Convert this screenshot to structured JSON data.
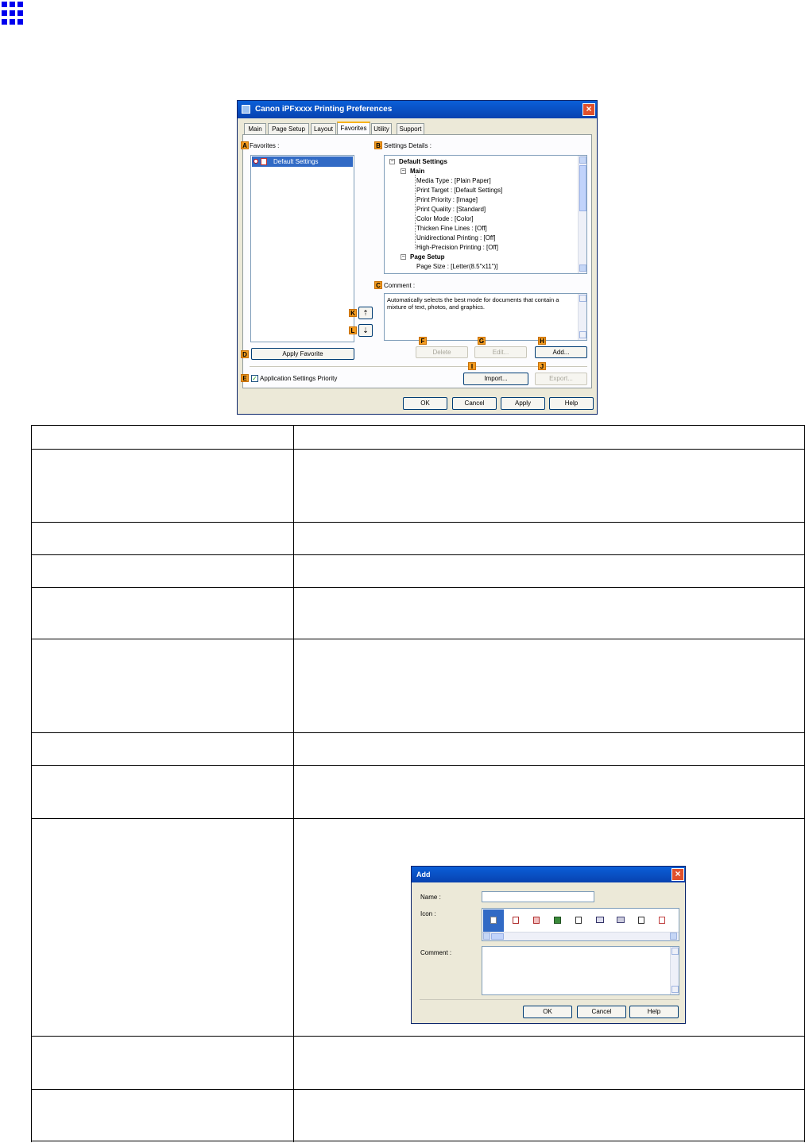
{
  "dialog": {
    "title": "Canon iPFxxxx Printing Preferences",
    "tabs": [
      "Main",
      "Page Setup",
      "Layout",
      "Favorites",
      "Utility",
      "Support"
    ],
    "selected_tab": "Favorites",
    "favorites_label": "Favorites :",
    "favorites_items": [
      "Default Settings"
    ],
    "settings_details_label": "Settings Details :",
    "tree": {
      "root": "Default Settings",
      "main_group": "Main",
      "main_items": [
        "Media Type : [Plain Paper]",
        "Print Target : [Default Settings]",
        "Print Priority : [Image]",
        "Print Quality : [Standard]",
        "Color Mode : [Color]",
        "Thicken Fine Lines : [Off]",
        "Unidirectional Printing : [Off]",
        "High-Precision Printing : [Off]"
      ],
      "page_group": "Page Setup",
      "page_items": [
        "Page Size : [Letter(8.5\"x11\")]"
      ]
    },
    "comment_label": "Comment :",
    "comment_text": "Automatically selects the best mode for documents that contain a mixture of text, photos, and graphics.",
    "buttons": {
      "delete": "Delete",
      "edit": "Edit...",
      "add": "Add...",
      "apply_favorite": "Apply Favorite",
      "import": "Import...",
      "export": "Export...",
      "ok": "OK",
      "cancel": "Cancel",
      "apply": "Apply",
      "help": "Help"
    },
    "app_settings_priority": "Application Settings Priority",
    "badges": [
      "A",
      "B",
      "C",
      "D",
      "E",
      "F",
      "G",
      "H",
      "I",
      "J",
      "K",
      "L"
    ]
  },
  "add_dialog": {
    "title": "Add",
    "name_label": "Name :",
    "name_value": "",
    "icon_label": "Icon :",
    "comment_label": "Comment :",
    "buttons": {
      "ok": "OK",
      "cancel": "Cancel",
      "help": "Help"
    }
  },
  "colors": {
    "titlebar": "#0a5fd8",
    "badge": "#f29b1f",
    "dialog_bg": "#ece9d8",
    "selection": "#316ac5",
    "grid_icon": "#0000ee"
  }
}
